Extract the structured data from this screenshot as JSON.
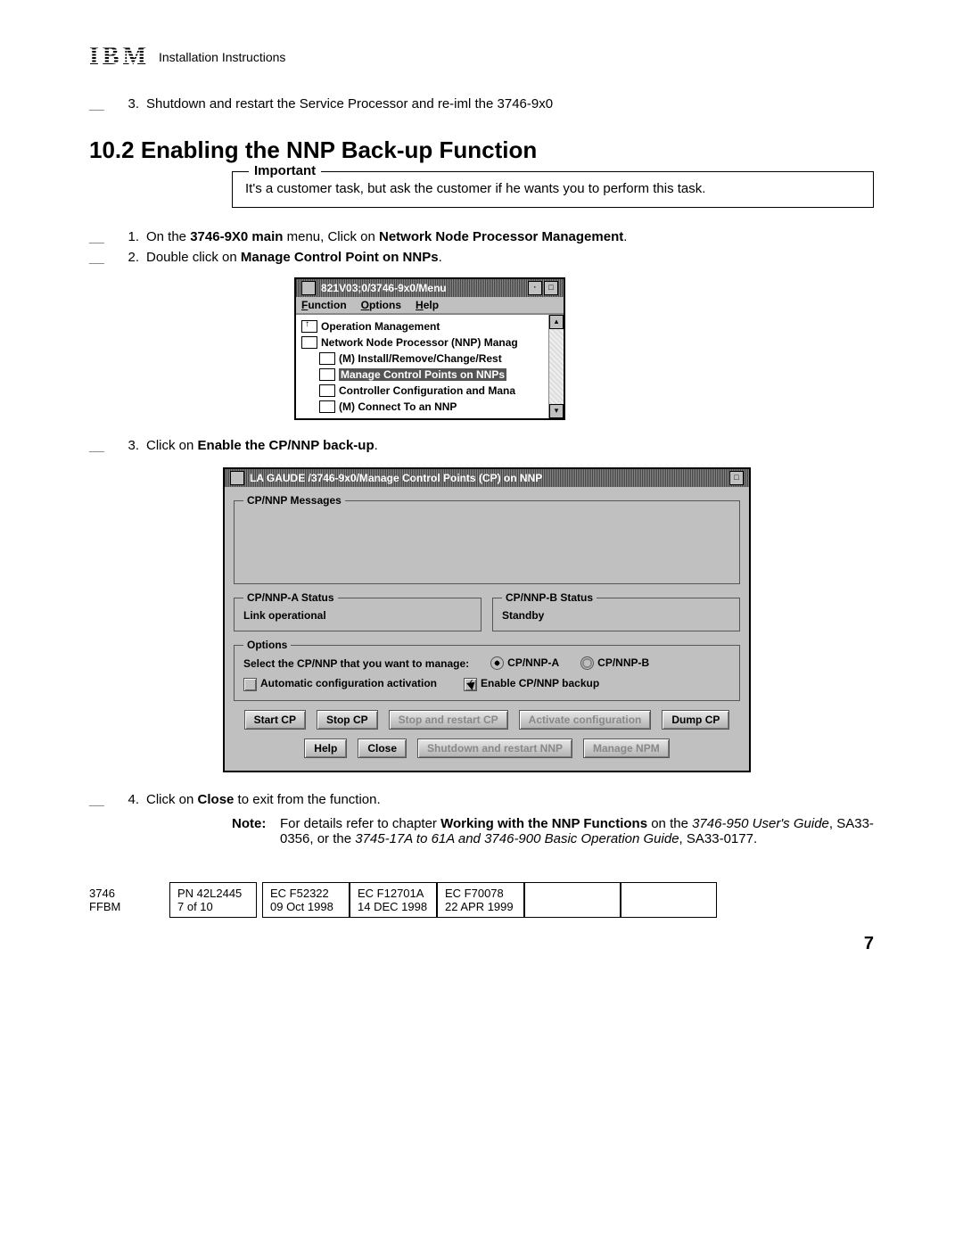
{
  "header": {
    "logo_text": "IBM",
    "doc_title": "Installation Instructions"
  },
  "top_step": {
    "num": "3.",
    "text": "Shutdown and restart the Service Processor and re-iml the 3746-9x0"
  },
  "section": {
    "heading": "10.2  Enabling the NNP Back-up Function",
    "important_legend": "Important",
    "important_text": "It's a customer task, but ask the customer if he wants you to perform this task."
  },
  "steps": {
    "s1": {
      "num": "1.",
      "pre": "On the ",
      "b1": "3746-9X0 main",
      "mid": " menu, Click on ",
      "b2": "Network Node Processor Management",
      "post": "."
    },
    "s2": {
      "num": "2.",
      "pre": "Double click on ",
      "b1": "Manage Control Point on NNPs",
      "post": "."
    },
    "s3": {
      "num": "3.",
      "pre": "Click on ",
      "b1": "Enable the CP/NNP back-up",
      "post": "."
    },
    "s4": {
      "num": "4.",
      "pre": "Click on ",
      "b1": "Close",
      "post": " to exit from the function."
    }
  },
  "menu_win": {
    "title": "821V03;0/3746-9x0/Menu",
    "menus": {
      "m1": "Function",
      "m2": "Options",
      "m3": "Help"
    },
    "items": {
      "i0": "Operation Management",
      "i1": "Network Node Processor (NNP) Manag",
      "i2": "(M) Install/Remove/Change/Rest",
      "i3": "Manage Control Points on NNPs",
      "i4": "Controller Configuration and Mana",
      "i5": "(M) Connect To an NNP"
    }
  },
  "dlg": {
    "title": "LA GAUDE /3746-9x0/Manage Control Points (CP) on NNP",
    "grp_msgs": "CP/NNP Messages",
    "grp_a": "CP/NNP-A Status",
    "grp_b": "CP/NNP-B Status",
    "status_a": "Link operational",
    "status_b": "Standby",
    "grp_opts": "Options",
    "opt_prompt": "Select the CP/NNP that you want to manage:",
    "radio_a": "CP/NNP-A",
    "radio_b": "CP/NNP-B",
    "check_auto": "Automatic configuration activation",
    "check_enable": "Enable CP/NNP backup",
    "buttons": {
      "b1": "Start CP",
      "b2": "Stop CP",
      "b3": "Stop and restart CP",
      "b4": "Activate configuration",
      "b5": "Dump CP",
      "b6": "Help",
      "b7": "Close",
      "b8": "Shutdown and restart NNP",
      "b9": "Manage NPM"
    }
  },
  "note": {
    "label": "Note:",
    "t1": "For details refer to chapter ",
    "b1": "Working with the NNP Functions",
    "t2": " on the ",
    "i1": "3746-950 User's Guide",
    "t3": ", SA33-0356, or the ",
    "i2": "3745-17A to 61A and 3746-900 Basic Operation Guide",
    "t4": ", SA33-0177."
  },
  "footer": {
    "lead1": "3746",
    "lead2": "FFBM",
    "c1a": "PN 42L2445",
    "c1b": "7 of 10",
    "c2a": "EC F52322",
    "c2b": "09 Oct 1998",
    "c3a": "EC F12701A",
    "c3b": "14 DEC 1998",
    "c4a": "EC F70078",
    "c4b": "22 APR 1999"
  },
  "page_number": "7"
}
